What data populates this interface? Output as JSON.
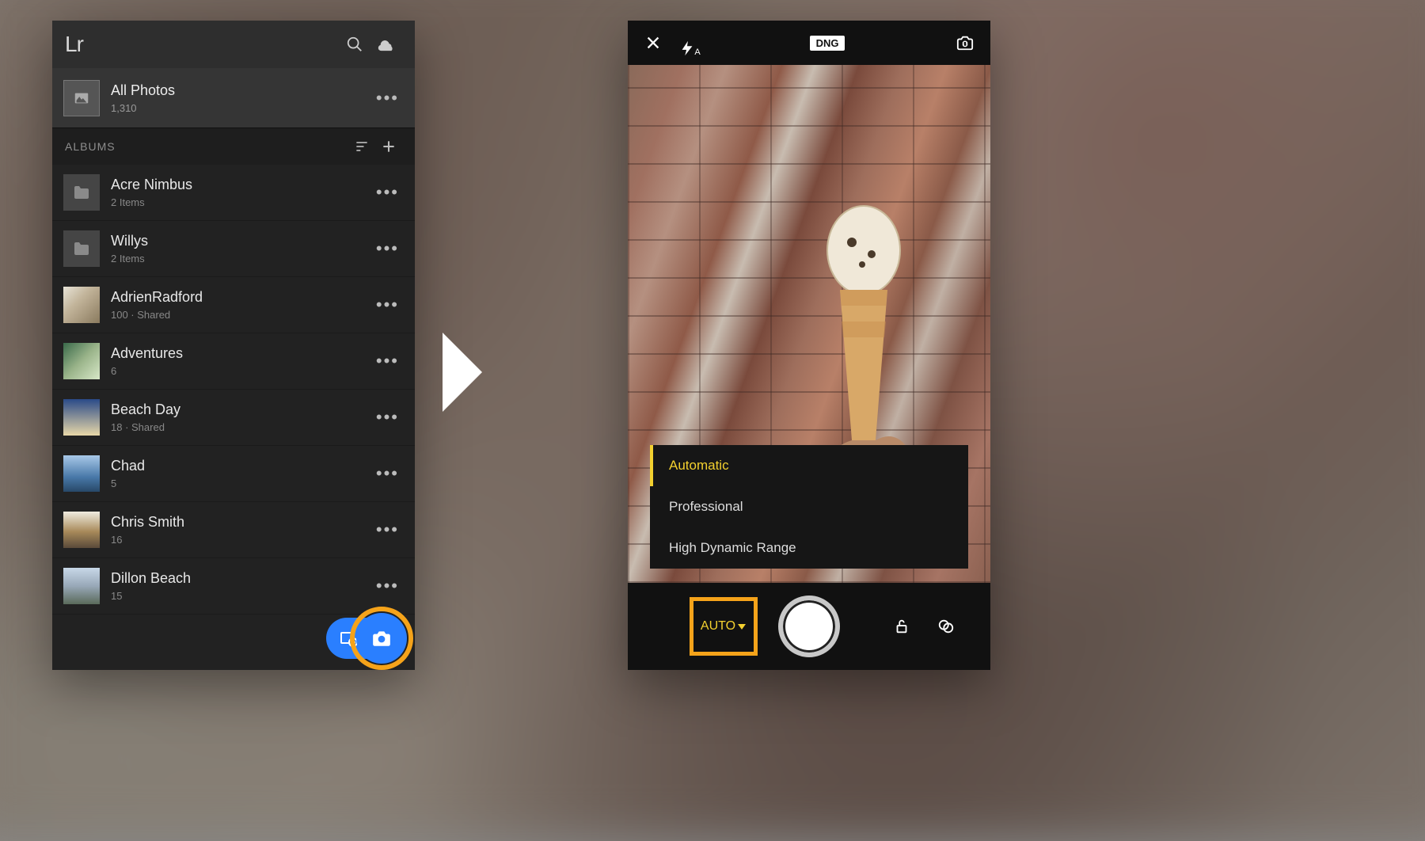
{
  "left": {
    "logo": "Lr",
    "allPhotos": {
      "title": "All Photos",
      "count": "1,310"
    },
    "albumsHeader": "ALBUMS",
    "albums": [
      {
        "type": "folder",
        "title": "Acre Nimbus",
        "sub": "2 Items"
      },
      {
        "type": "folder",
        "title": "Willys",
        "sub": "2 Items"
      },
      {
        "type": "photo",
        "title": "AdrienRadford",
        "sub": "100 · Shared",
        "bg": "linear-gradient(135deg,#e8e4d8,#c2b49a 40%,#8a7a5e)"
      },
      {
        "type": "photo",
        "title": "Adventures",
        "sub": "6",
        "bg": "linear-gradient(135deg,#3a6a4a,#9ab48a 50%,#d8e8c8)"
      },
      {
        "type": "photo",
        "title": "Beach Day",
        "sub": "18 · Shared",
        "bg": "linear-gradient(180deg,#2a4a88,#e8d8a8)"
      },
      {
        "type": "photo",
        "title": "Chad",
        "sub": "5",
        "bg": "linear-gradient(180deg,#a8c8e8,#4878a8 60%,#284868)"
      },
      {
        "type": "photo",
        "title": "Chris Smith",
        "sub": "16",
        "bg": "linear-gradient(180deg,#f0ece0,#a88a5a 55%,#5a4a3a)"
      },
      {
        "type": "photo",
        "title": "Dillon Beach",
        "sub": "15",
        "bg": "linear-gradient(180deg,#c8d8e8,#98a8b8 50%,#5a6a5a)"
      }
    ]
  },
  "right": {
    "flashMode": "A",
    "format": "DNG",
    "modes": [
      {
        "label": "Automatic",
        "active": true
      },
      {
        "label": "Professional",
        "active": false
      },
      {
        "label": "High Dynamic Range",
        "active": false
      }
    ],
    "autoLabel": "AUTO"
  },
  "colors": {
    "highlight": "#f5a31a",
    "accentBlue": "#2a7fff",
    "accentYellow": "#f3d02f"
  }
}
